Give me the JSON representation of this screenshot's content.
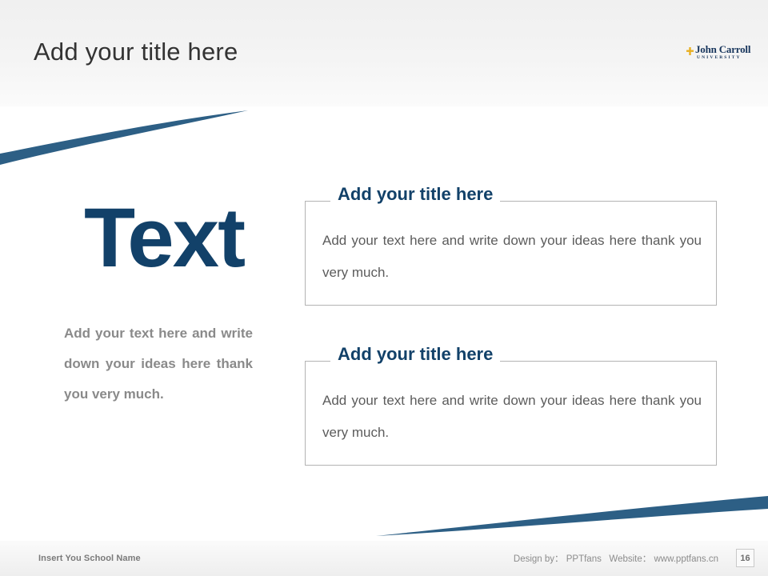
{
  "slide": {
    "title": "Add your title here",
    "accent_navy": "#124169",
    "swoosh_blue": "#2d5f85",
    "body_gray": "#5c5c5c",
    "muted_gray": "#8a8a8a"
  },
  "logo": {
    "icon": "cross-icon",
    "name": "John Carroll",
    "subtitle": "UNIVERSITY",
    "color": "#17355c",
    "icon_color": "#e8b023"
  },
  "left": {
    "headline": "Text",
    "body": "Add your text here and write down your ideas here thank you very much."
  },
  "panels": [
    {
      "title": "Add your title here",
      "body": "Add your text here and write down your ideas here thank you very much."
    },
    {
      "title": "Add your title here",
      "body": "Add your text here and write down your ideas here thank you very much."
    }
  ],
  "footer": {
    "school_name": "Insert You School Name",
    "credit": "Design by： PPTfans   Website： www.pptfans.cn",
    "page_number": "16"
  }
}
